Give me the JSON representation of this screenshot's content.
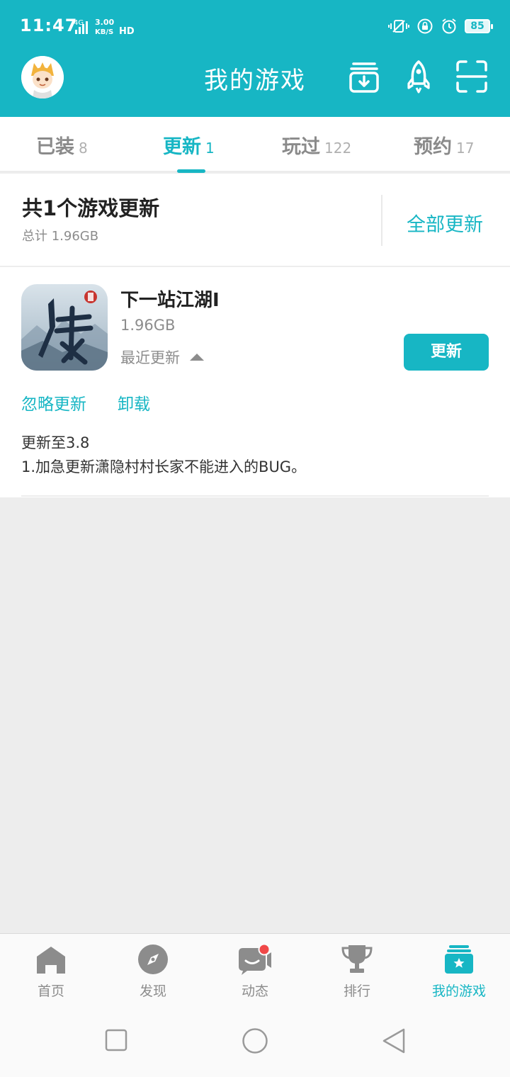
{
  "status_bar": {
    "time": "11:47",
    "network_type": "4G",
    "speed_value": "3.00",
    "speed_unit": "KB/S",
    "hd_label": "HD",
    "battery": "85"
  },
  "header": {
    "title": "我的游戏",
    "icons": [
      "avatar",
      "download-icon",
      "rocket-icon",
      "scan-icon"
    ]
  },
  "tabs": [
    {
      "label": "已装",
      "count": "8",
      "active": false
    },
    {
      "label": "更新",
      "count": "1",
      "active": true
    },
    {
      "label": "玩过",
      "count": "122",
      "active": false
    },
    {
      "label": "预约",
      "count": "17",
      "active": false
    }
  ],
  "summary": {
    "title": "共1个游戏更新",
    "total": "总计  1.96GB",
    "update_all": "全部更新"
  },
  "game": {
    "name": "下一站江湖Ⅰ",
    "size": "1.96GB",
    "recent": "最近更新",
    "update_button": "更新",
    "ignore": "忽略更新",
    "uninstall": "卸载",
    "notes_header": "更新至3.8",
    "notes_body": "1.加急更新潇隐村村长家不能进入的BUG。"
  },
  "bottom_nav": [
    {
      "label": "首页",
      "icon": "home-icon",
      "active": false
    },
    {
      "label": "发现",
      "icon": "compass-icon",
      "active": false
    },
    {
      "label": "动态",
      "icon": "feed-icon",
      "active": false,
      "badge": true
    },
    {
      "label": "排行",
      "icon": "trophy-icon",
      "active": false
    },
    {
      "label": "我的游戏",
      "icon": "my-games-icon",
      "active": true
    }
  ],
  "colors": {
    "accent": "#17b6c4",
    "background": "#ededed",
    "text_primary": "#222222",
    "text_secondary": "#8c8c8c",
    "badge": "#f04848"
  }
}
